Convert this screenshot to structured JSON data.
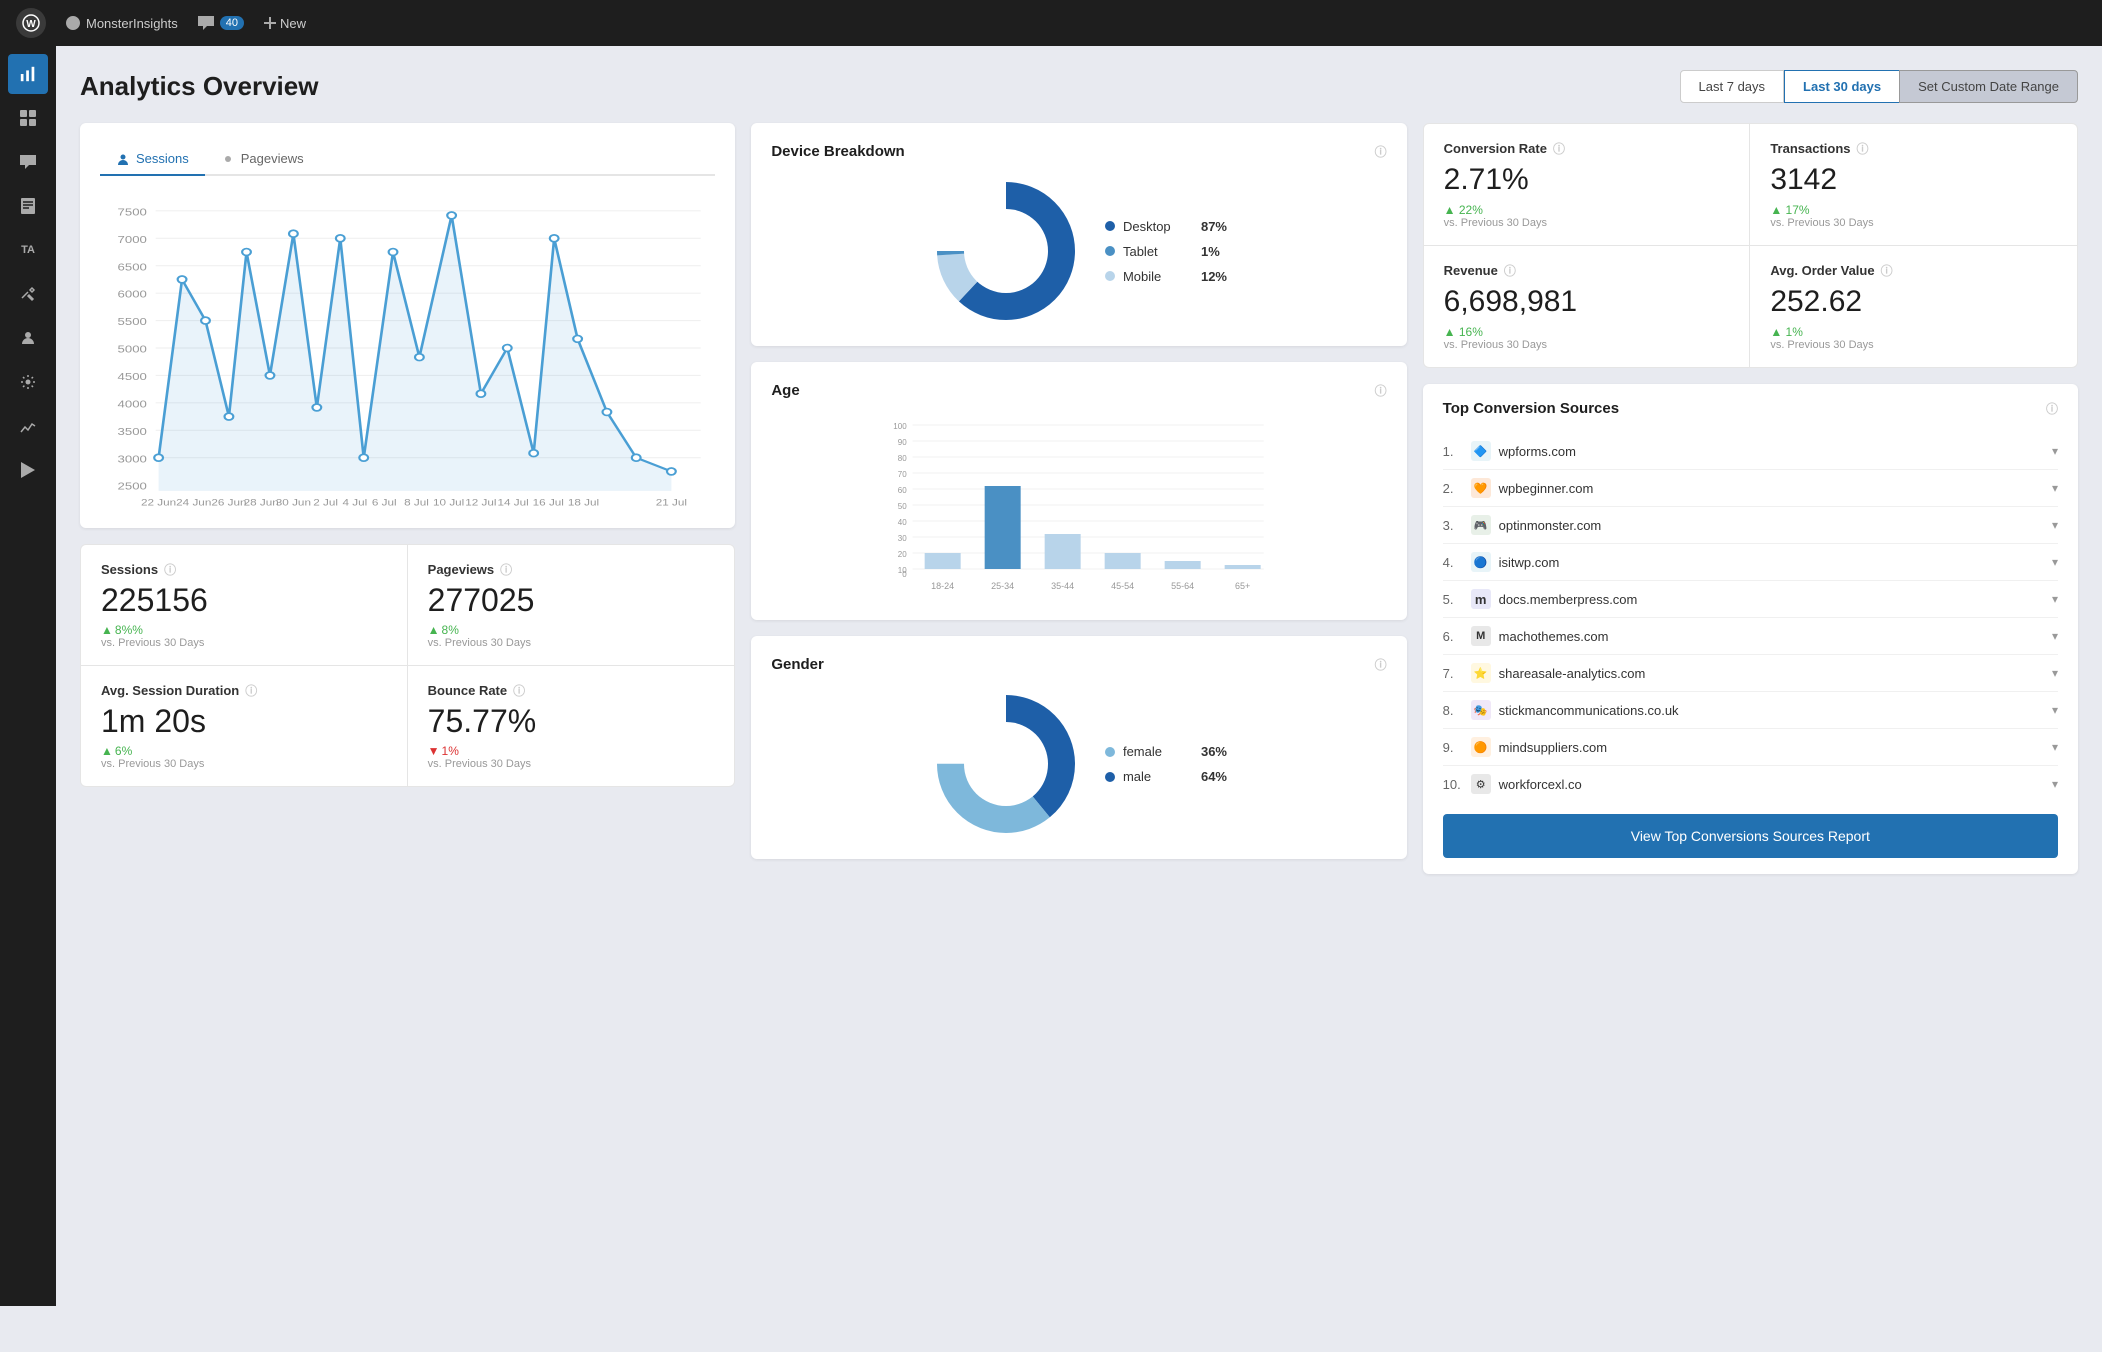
{
  "topnav": {
    "wp_logo": "W",
    "site_name": "MonsterInsights",
    "comments_count": "40",
    "new_label": "New"
  },
  "sidebar": {
    "items": [
      {
        "id": "monsterinsights",
        "icon": "📊",
        "active": true
      },
      {
        "id": "dashboard",
        "icon": "⊞"
      },
      {
        "id": "search",
        "icon": "🔍"
      },
      {
        "id": "pages",
        "icon": "📄"
      },
      {
        "id": "comments",
        "icon": "💬"
      },
      {
        "id": "ta",
        "icon": "TA",
        "is_text": true
      },
      {
        "id": "tools",
        "icon": "🔧"
      },
      {
        "id": "appearance",
        "icon": "🎨"
      },
      {
        "id": "users",
        "icon": "👤"
      },
      {
        "id": "settings",
        "icon": "⚙️"
      },
      {
        "id": "plugins",
        "icon": "🧩"
      },
      {
        "id": "analytics",
        "icon": "📈"
      },
      {
        "id": "play",
        "icon": "▶"
      }
    ]
  },
  "page": {
    "title": "Analytics Overview",
    "date_buttons": [
      {
        "label": "Last 7 days",
        "active": false
      },
      {
        "label": "Last 30 days",
        "active": true
      },
      {
        "label": "Set Custom Date Range",
        "active": false,
        "is_custom": true
      }
    ]
  },
  "chart": {
    "tabs": [
      {
        "label": "Sessions",
        "active": true,
        "icon": "👤"
      },
      {
        "label": "Pageviews",
        "active": false,
        "icon": "👁"
      }
    ],
    "y_labels": [
      "7500",
      "7000",
      "6500",
      "6000",
      "5500",
      "5000",
      "4500",
      "4000",
      "3500",
      "3000",
      "2500"
    ],
    "x_labels": [
      "22 Jun",
      "24 Jun",
      "26 Jun",
      "28 Jun",
      "30 Jun",
      "2 Jul",
      "4 Jul",
      "6 Jul",
      "8 Jul",
      "10 Jul",
      "12 Jul",
      "14 Jul",
      "16 Jul",
      "18 Jul",
      "21 Jul"
    ]
  },
  "stats": [
    {
      "label": "Sessions",
      "value": "225156",
      "change": "8%%",
      "change_dir": "up",
      "sub": "vs. Previous 30 Days"
    },
    {
      "label": "Pageviews",
      "value": "277025",
      "change": "8%",
      "change_dir": "up",
      "sub": "vs. Previous 30 Days"
    },
    {
      "label": "Avg. Session Duration",
      "value": "1m 20s",
      "change": "6%",
      "change_dir": "up",
      "sub": "vs. Previous 30 Days"
    },
    {
      "label": "Bounce Rate",
      "value": "75.77%",
      "change": "1%",
      "change_dir": "down",
      "sub": "vs. Previous 30 Days"
    }
  ],
  "device_breakdown": {
    "title": "Device Breakdown",
    "items": [
      {
        "label": "Desktop",
        "value": "87%",
        "color": "#1e5fa8",
        "pct": 87
      },
      {
        "label": "Tablet",
        "value": "1%",
        "color": "#4a90c4",
        "pct": 1
      },
      {
        "label": "Mobile",
        "value": "12%",
        "color": "#b8d4ea",
        "pct": 12
      }
    ]
  },
  "age": {
    "title": "Age",
    "groups": [
      {
        "label": "18-24",
        "value": 10
      },
      {
        "label": "25-34",
        "value": 52
      },
      {
        "label": "35-44",
        "value": 22
      },
      {
        "label": "45-54",
        "value": 10
      },
      {
        "label": "55-64",
        "value": 5
      },
      {
        "label": "65+",
        "value": 3
      }
    ],
    "y_max": 100,
    "y_labels": [
      "100",
      "90",
      "80",
      "70",
      "60",
      "50",
      "40",
      "30",
      "20",
      "10",
      "0"
    ]
  },
  "gender": {
    "title": "Gender",
    "items": [
      {
        "label": "female",
        "value": "36%",
        "color": "#7eb8db",
        "pct": 36
      },
      {
        "label": "male",
        "value": "64%",
        "color": "#1e5fa8",
        "pct": 64
      }
    ]
  },
  "metrics": [
    {
      "label": "Conversion Rate",
      "value": "2.71%",
      "change": "22%",
      "change_dir": "up",
      "sub": "vs. Previous 30 Days"
    },
    {
      "label": "Transactions",
      "value": "3142",
      "change": "17%",
      "change_dir": "up",
      "sub": "vs. Previous 30 Days"
    },
    {
      "label": "Revenue",
      "value": "6,698,981",
      "change": "16%",
      "change_dir": "up",
      "sub": "vs. Previous 30 Days"
    },
    {
      "label": "Avg. Order Value",
      "value": "252.62",
      "change": "1%",
      "change_dir": "up",
      "sub": "vs. Previous 30 Days"
    }
  ],
  "top_sources": {
    "title": "Top Conversion Sources",
    "items": [
      {
        "num": "1.",
        "name": "wpforms.com",
        "icon_color": "#e8f4f8",
        "icon_text": "🔷"
      },
      {
        "num": "2.",
        "name": "wpbeginner.com",
        "icon_color": "#fde8d8",
        "icon_text": "🧡"
      },
      {
        "num": "3.",
        "name": "optinmonster.com",
        "icon_color": "#e8f0e8",
        "icon_text": "🎮"
      },
      {
        "num": "4.",
        "name": "isitwp.com",
        "icon_color": "#e8f4f8",
        "icon_text": "🔵"
      },
      {
        "num": "5.",
        "name": "docs.memberpress.com",
        "icon_color": "#e8e8f8",
        "icon_text": "Ⓜ"
      },
      {
        "num": "6.",
        "name": "machothemes.com",
        "icon_color": "#e8e8e8",
        "icon_text": "Ⓜ"
      },
      {
        "num": "7.",
        "name": "shareasale-analytics.com",
        "icon_color": "#fff8e0",
        "icon_text": "⭐"
      },
      {
        "num": "8.",
        "name": "stickmancommunications.co.uk",
        "icon_color": "#f0e8f8",
        "icon_text": "🎭"
      },
      {
        "num": "9.",
        "name": "mindsuppliers.com",
        "icon_color": "#fff0e0",
        "icon_text": "🟠"
      },
      {
        "num": "10.",
        "name": "workforcexl.co",
        "icon_color": "#e8e8e8",
        "icon_text": "⚙"
      }
    ],
    "view_report_label": "View Top Conversions Sources Report"
  }
}
